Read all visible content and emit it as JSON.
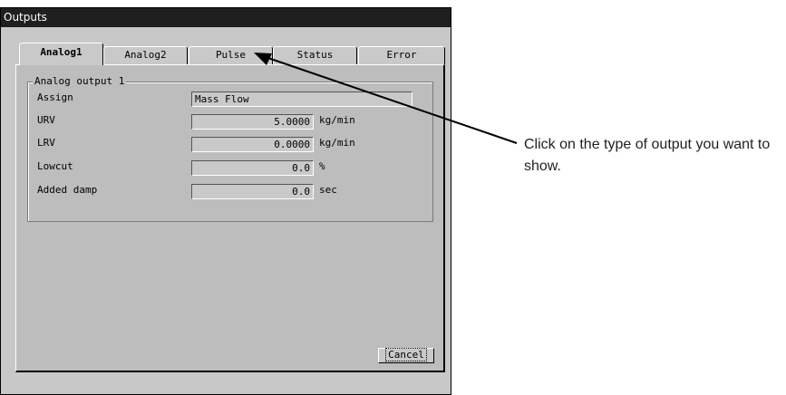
{
  "window": {
    "title": "Outputs"
  },
  "tabs": [
    {
      "label": "Analog1",
      "active": true
    },
    {
      "label": "Analog2",
      "active": false
    },
    {
      "label": "Pulse",
      "active": false
    },
    {
      "label": "Status",
      "active": false
    },
    {
      "label": "Error",
      "active": false
    }
  ],
  "group": {
    "title": "Analog output 1",
    "rows": [
      {
        "label": "Assign",
        "value": "Mass Flow",
        "unit": ""
      },
      {
        "label": "URV",
        "value": "5.0000",
        "unit": "kg/min"
      },
      {
        "label": "LRV",
        "value": "0.0000",
        "unit": "kg/min"
      },
      {
        "label": "Lowcut",
        "value": "0.0",
        "unit": "%"
      },
      {
        "label": "Added damp",
        "value": "0.0",
        "unit": "sec"
      }
    ]
  },
  "buttons": {
    "cancel": "Cancel"
  },
  "annotation": "Click on the type of output you want to show."
}
